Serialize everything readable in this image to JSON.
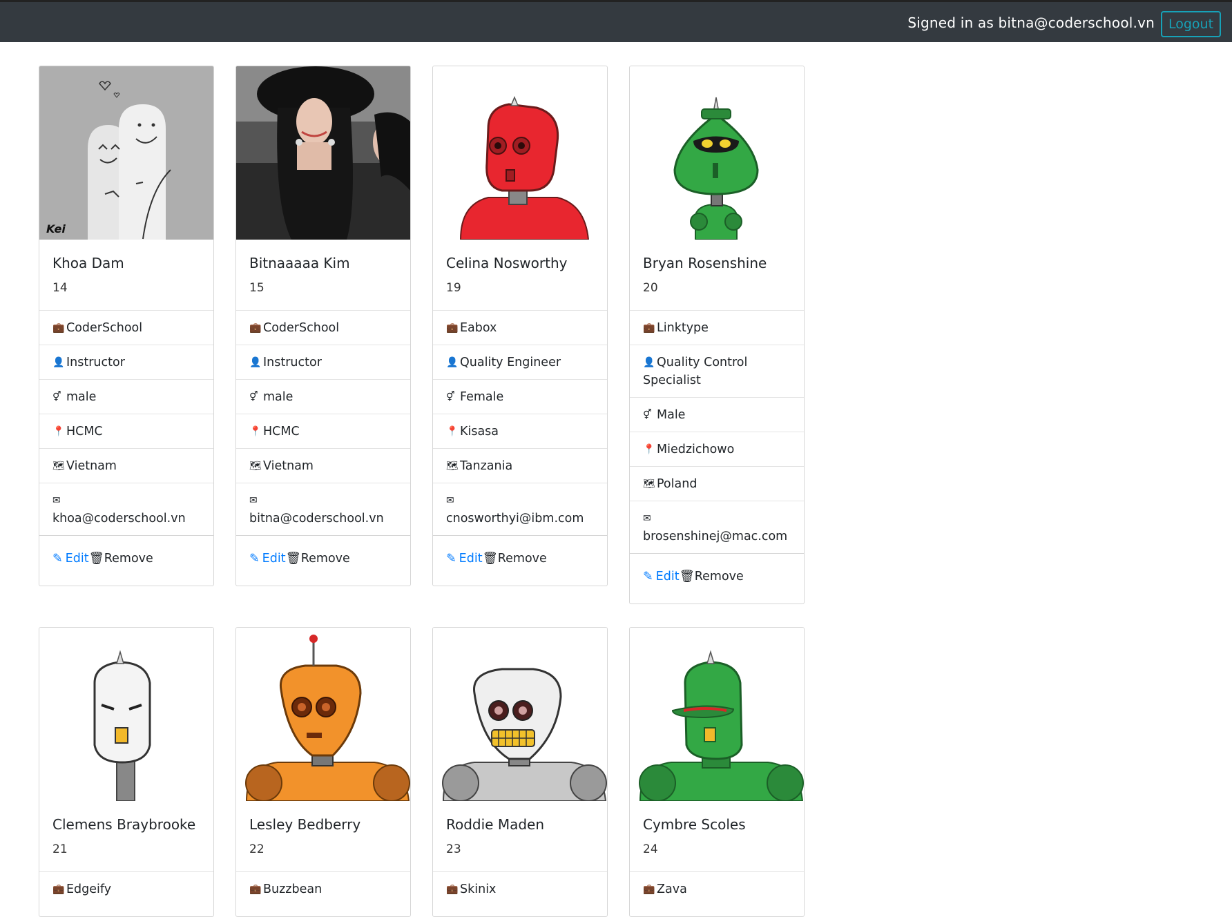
{
  "navbar": {
    "signed_in_text": "Signed in as bitna@coderschool.vn",
    "logout_label": "Logout"
  },
  "cards": [
    {
      "name": "Khoa Dam",
      "age": "14",
      "company": "CoderSchool",
      "job": "Instructor",
      "gender": "male",
      "city": "HCMC",
      "country": "Vietnam",
      "email": "khoa@coderschool.vn",
      "avatar": "fingers-photo"
    },
    {
      "name": "Bitnaaaaa Kim",
      "age": "15",
      "company": "CoderSchool",
      "job": "Instructor",
      "gender": "male",
      "city": "HCMC",
      "country": "Vietnam",
      "email": "bitna@coderschool.vn",
      "avatar": "woman-photo"
    },
    {
      "name": "Celina Nosworthy",
      "age": "19",
      "company": "Eabox",
      "job": "Quality Engineer",
      "gender": "Female",
      "city": "Kisasa",
      "country": "Tanzania",
      "email": "cnosworthyi@ibm.com",
      "avatar": "red-robot"
    },
    {
      "name": "Bryan Rosenshine",
      "age": "20",
      "company": "Linktype",
      "job": "Quality Control Specialist",
      "gender": "Male",
      "city": "Miedzichowo",
      "country": "Poland",
      "email": "brosenshinej@mac.com",
      "avatar": "green-robot"
    },
    {
      "name": "Clemens Braybrooke",
      "age": "21",
      "company": "Edgeify",
      "avatar": "white-robot"
    },
    {
      "name": "Lesley Bedberry",
      "age": "22",
      "company": "Buzzbean",
      "avatar": "orange-robot"
    },
    {
      "name": "Roddie Maden",
      "age": "23",
      "company": "Skinix",
      "avatar": "gray-robot"
    },
    {
      "name": "Cymbre Scoles",
      "age": "24",
      "company": "Zava",
      "avatar": "green-robot-2"
    }
  ],
  "labels": {
    "edit": "Edit",
    "remove": "Remove"
  },
  "icons": {
    "company": "briefcase-icon",
    "job": "user-tie-icon",
    "gender": "genderless-icon",
    "city": "map-pin-icon",
    "country": "map-icon",
    "email": "envelope-icon",
    "edit": "edit-icon",
    "remove": "trash-icon"
  },
  "colors": {
    "navbar": "#343a40",
    "logout": "#17a2b8",
    "link": "#007bff",
    "red_robot": "#e8262f",
    "green_robot": "#33a845",
    "orange_robot": "#f2922b"
  }
}
